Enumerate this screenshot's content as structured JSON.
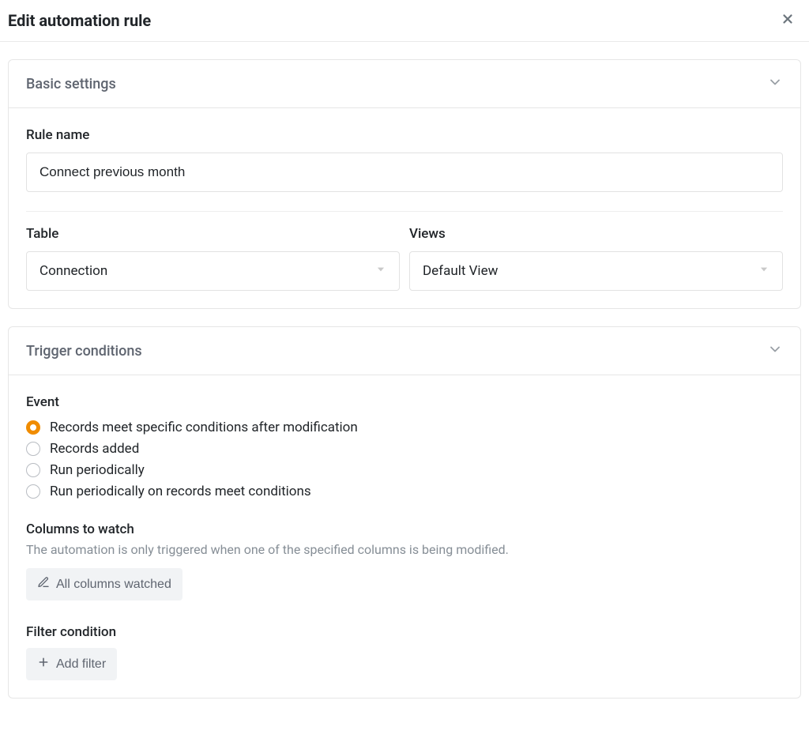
{
  "header": {
    "title": "Edit automation rule"
  },
  "basic": {
    "panel_title": "Basic settings",
    "rule_name_label": "Rule name",
    "rule_name_value": "Connect previous month",
    "table_label": "Table",
    "table_value": "Connection",
    "views_label": "Views",
    "views_value": "Default View"
  },
  "trigger": {
    "panel_title": "Trigger conditions",
    "event_label": "Event",
    "events": [
      "Records meet specific conditions after modification",
      "Records added",
      "Run periodically",
      "Run periodically on records meet conditions"
    ],
    "selected_event_index": 0,
    "columns_label": "Columns to watch",
    "columns_helper": "The automation is only triggered when one of the specified columns is being modified.",
    "columns_button": "All columns watched",
    "filter_label": "Filter condition",
    "filter_button": "Add filter"
  }
}
